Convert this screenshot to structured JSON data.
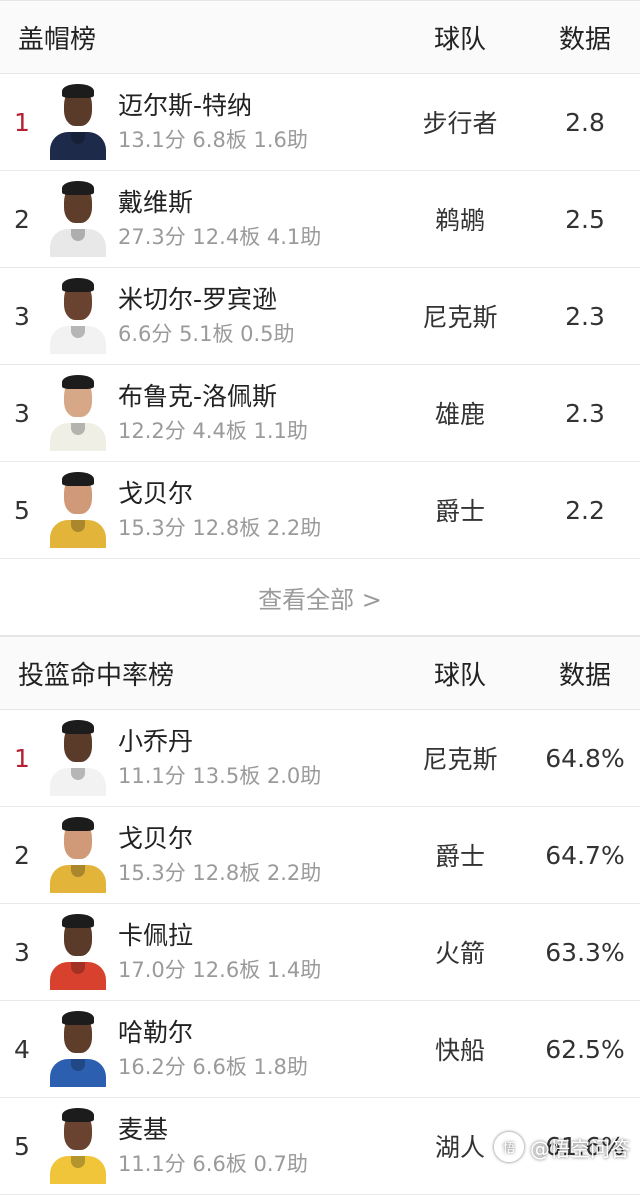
{
  "blocks": {
    "title": "盖帽榜",
    "col_team": "球队",
    "col_stat": "数据",
    "players": [
      {
        "rank": "1",
        "name": "迈尔斯-特纳",
        "line": "13.1分 6.8板 1.6助",
        "team": "步行者",
        "stat": "2.8",
        "jersey": "#1d2a4a",
        "skin": "#5a3a28"
      },
      {
        "rank": "2",
        "name": "戴维斯",
        "line": "27.3分 12.4板 4.1助",
        "team": "鹈鹕",
        "stat": "2.5",
        "jersey": "#e8e8e8",
        "skin": "#5e3d2b"
      },
      {
        "rank": "3",
        "name": "米切尔-罗宾逊",
        "line": "6.6分 5.1板 0.5助",
        "team": "尼克斯",
        "stat": "2.3",
        "jersey": "#f2f2f2",
        "skin": "#6a4330"
      },
      {
        "rank": "3",
        "name": "布鲁克-洛佩斯",
        "line": "12.2分 4.4板 1.1助",
        "team": "雄鹿",
        "stat": "2.3",
        "jersey": "#f0efe6",
        "skin": "#d7a888"
      },
      {
        "rank": "5",
        "name": "戈贝尔",
        "line": "15.3分 12.8板 2.2助",
        "team": "爵士",
        "stat": "2.2",
        "jersey": "#e3b43a",
        "skin": "#d09a78"
      }
    ],
    "more_label": "查看全部 >"
  },
  "fg": {
    "title": "投篮命中率榜",
    "col_team": "球队",
    "col_stat": "数据",
    "players": [
      {
        "rank": "1",
        "name": "小乔丹",
        "line": "11.1分 13.5板 2.0助",
        "team": "尼克斯",
        "stat": "64.8%",
        "jersey": "#f2f2f2",
        "skin": "#5a3a28"
      },
      {
        "rank": "2",
        "name": "戈贝尔",
        "line": "15.3分 12.8板 2.2助",
        "team": "爵士",
        "stat": "64.7%",
        "jersey": "#e3b43a",
        "skin": "#d09a78"
      },
      {
        "rank": "3",
        "name": "卡佩拉",
        "line": "17.0分 12.6板 1.4助",
        "team": "火箭",
        "stat": "63.3%",
        "jersey": "#d9412f",
        "skin": "#5a3a28"
      },
      {
        "rank": "4",
        "name": "哈勒尔",
        "line": "16.2分 6.6板 1.8助",
        "team": "快船",
        "stat": "62.5%",
        "jersey": "#2c5fb0",
        "skin": "#5e3d2b"
      },
      {
        "rank": "5",
        "name": "麦基",
        "line": "11.1分 6.6板 0.7助",
        "team": "湖人",
        "stat": "61.6%",
        "jersey": "#f0c53a",
        "skin": "#6a4330"
      }
    ]
  },
  "watermark": {
    "logo": "悟",
    "text": "@悟空问答"
  }
}
